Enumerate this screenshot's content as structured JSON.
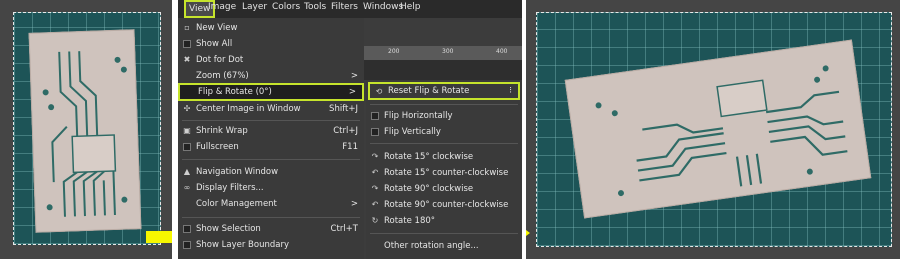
{
  "menubar": {
    "items": [
      "View",
      "Image",
      "Layer",
      "Colors",
      "Tools",
      "Filters",
      "Windows",
      "Help"
    ]
  },
  "ruler": {
    "labels": [
      "200",
      "300",
      "400"
    ]
  },
  "view_menu": {
    "items": [
      {
        "label": "New View",
        "shortcut": "",
        "icon": "new-view-icon"
      },
      {
        "label": "Show All",
        "shortcut": "",
        "icon": "checkbox-icon"
      },
      {
        "label": "Dot for Dot",
        "shortcut": "",
        "icon": "x-mark-icon"
      },
      {
        "label": "Zoom (67%)",
        "shortcut": "",
        "icon": "",
        "submenu": ">"
      },
      {
        "label": "Flip & Rotate (0°)",
        "shortcut": "",
        "icon": "",
        "submenu": ">"
      },
      {
        "label": "Center Image in Window",
        "shortcut": "Shift+J",
        "icon": "center-icon"
      },
      {
        "label": "Shrink Wrap",
        "shortcut": "Ctrl+J",
        "icon": "shrink-wrap-icon"
      },
      {
        "label": "Fullscreen",
        "shortcut": "F11",
        "icon": "fullscreen-icon"
      },
      {
        "label": "Navigation Window",
        "shortcut": "",
        "icon": "navigation-icon"
      },
      {
        "label": "Display Filters...",
        "shortcut": "",
        "icon": "display-filters-icon"
      },
      {
        "label": "Color Management",
        "shortcut": "",
        "icon": "",
        "submenu": ">"
      },
      {
        "label": "Show Selection",
        "shortcut": "Ctrl+T",
        "icon": "checkbox-icon"
      },
      {
        "label": "Show Layer Boundary",
        "shortcut": "",
        "icon": "checkbox-icon"
      }
    ]
  },
  "flip_menu": {
    "items": [
      {
        "label": "Reset Flip & Rotate",
        "icon": "reset-icon"
      },
      {
        "label": "Flip Horizontally",
        "icon": "checkbox-icon"
      },
      {
        "label": "Flip Vertically",
        "icon": "checkbox-icon"
      },
      {
        "label": "Rotate 15° clockwise",
        "icon": "rotate-cw-icon"
      },
      {
        "label": "Rotate 15° counter-clockwise",
        "icon": "rotate-ccw-icon"
      },
      {
        "label": "Rotate 90° clockwise",
        "icon": "rotate-cw-icon"
      },
      {
        "label": "Rotate 90° counter-clockwise",
        "icon": "rotate-ccw-icon"
      },
      {
        "label": "Rotate 180°",
        "icon": "rotate-180-icon"
      },
      {
        "label": "Other rotation angle...",
        "icon": ""
      }
    ],
    "tearoff": "⁝"
  },
  "colors": {
    "highlight": "#c6e42c",
    "arrow": "#f7f700"
  }
}
